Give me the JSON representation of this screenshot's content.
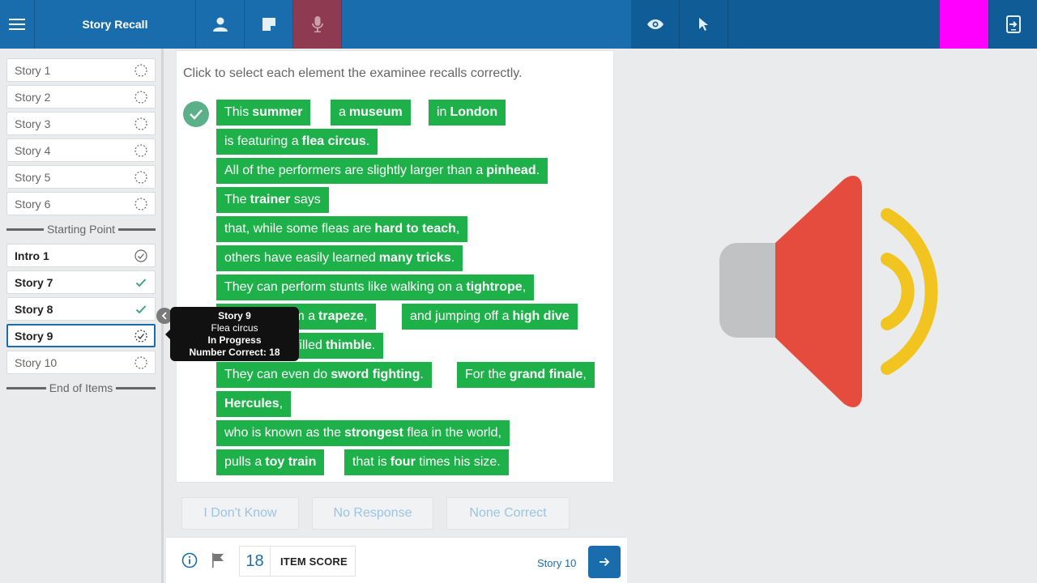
{
  "app": {
    "title": "Story Recall"
  },
  "topbar": {
    "icons": [
      "menu-icon",
      "person-icon",
      "note-icon",
      "microphone-icon",
      "eye-icon",
      "cursor-icon",
      "exit-icon"
    ],
    "colors": {
      "bar": "#1a6dad",
      "bar_right": "#0f5c96",
      "mic_active": "#8e3a50",
      "magenta_block": "#ff00ff"
    }
  },
  "sidebar": {
    "items": [
      {
        "label": "Story 1",
        "status": "not-started"
      },
      {
        "label": "Story 2",
        "status": "not-started"
      },
      {
        "label": "Story 3",
        "status": "not-started"
      },
      {
        "label": "Story 4",
        "status": "not-started"
      },
      {
        "label": "Story 5",
        "status": "not-started"
      },
      {
        "label": "Story 6",
        "status": "not-started"
      },
      {
        "label": "Intro 1",
        "status": "complete-circle"
      },
      {
        "label": "Story 7",
        "status": "complete"
      },
      {
        "label": "Story 8",
        "status": "complete"
      },
      {
        "label": "Story 9",
        "status": "in-progress"
      },
      {
        "label": "Story 10",
        "status": "not-started"
      }
    ],
    "starting_point_label": "Starting Point",
    "end_label": "End of Items"
  },
  "tooltip": {
    "title": "Story 9",
    "subtitle": "Flea circus",
    "status": "In Progress",
    "correct": "Number Correct: 18"
  },
  "main": {
    "instruction": "Click to select each element the examinee recalls correctly.",
    "elements": [
      {
        "pre": "This",
        "bold": "summer",
        "post": ""
      },
      {
        "pre": "a",
        "bold": "museum",
        "post": ""
      },
      {
        "pre": "in",
        "bold": "London",
        "post": ""
      },
      {
        "pre": "is featuring a",
        "bold": "flea circus",
        "post": "."
      },
      {
        "pre": "All of the performers are slightly larger than a",
        "bold": "pinhead",
        "post": "."
      },
      {
        "pre": "The",
        "bold": "trainer",
        "post": " says"
      },
      {
        "pre": "that, while some fleas are",
        "bold": "hard to teach",
        "post": ","
      },
      {
        "pre": "others have easily learned",
        "bold": "many tricks",
        "post": "."
      },
      {
        "pre": "They can perform stunts like walking on a",
        "bold": "tightrope",
        "post": ","
      },
      {
        "pre": "swinging from a",
        "bold": "trapeze",
        "post": ","
      },
      {
        "pre": "and jumping off a",
        "bold": "high dive",
        "post": ""
      },
      {
        "pre": "into a water-filled",
        "bold": "thimble",
        "post": "."
      },
      {
        "pre": "They can even do",
        "bold": "sword fighting",
        "post": "."
      },
      {
        "pre": "For the",
        "bold": "grand finale",
        "post": ","
      },
      {
        "pre": "",
        "bold": "Hercules",
        "post": ","
      },
      {
        "pre": "who is known as the",
        "bold": "strongest",
        "post": " flea in the world,"
      },
      {
        "pre": "pulls a",
        "bold": "toy train",
        "post": ""
      },
      {
        "pre": "that is",
        "bold": "four",
        "post": " times his size."
      }
    ],
    "responses": [
      "I Don't Know",
      "No Response",
      "None Correct"
    ],
    "chip_color": "#1eb14a"
  },
  "footer": {
    "score": "18",
    "score_label": "ITEM SCORE",
    "next_label": "Story 10"
  },
  "right_pane": {
    "image": "speaker-audio-icon",
    "colors": {
      "speaker_body": "#c0c2c4",
      "speaker_cone": "#e64c3d",
      "waves": "#f2c41f"
    }
  }
}
